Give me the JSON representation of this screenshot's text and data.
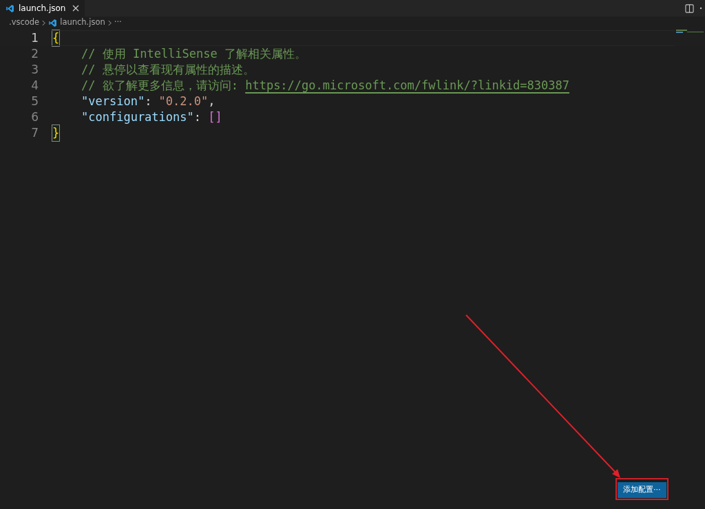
{
  "tabs": [
    {
      "label": "launch.json",
      "selected": true
    }
  ],
  "breadcrumbs": [
    {
      "label": ".vscode",
      "kind": "folder"
    },
    {
      "label": "launch.json",
      "kind": "file"
    },
    {
      "label": "···",
      "kind": "more"
    }
  ],
  "lines": [
    {
      "number": "1",
      "current": true,
      "indented": false,
      "tokens": [
        {
          "kind": "brace",
          "text": "{",
          "matched": true
        }
      ]
    },
    {
      "number": "2",
      "current": false,
      "indented": true,
      "tokens": [
        {
          "kind": "comment",
          "text": "// 使用 IntelliSense 了解相关属性。"
        }
      ]
    },
    {
      "number": "3",
      "current": false,
      "indented": true,
      "tokens": [
        {
          "kind": "comment",
          "text": "// 悬停以查看现有属性的描述。"
        }
      ]
    },
    {
      "number": "4",
      "current": false,
      "indented": true,
      "tokens": [
        {
          "kind": "comment",
          "text": "// 欲了解更多信息，请访问: "
        },
        {
          "kind": "link",
          "text": "https://go.microsoft.com/fwlink/?linkid=830387"
        }
      ]
    },
    {
      "number": "5",
      "current": false,
      "indented": true,
      "tokens": [
        {
          "kind": "key",
          "text": "\"version\""
        },
        {
          "kind": "punct",
          "text": ": "
        },
        {
          "kind": "string",
          "text": "\"0.2.0\""
        },
        {
          "kind": "punct",
          "text": ","
        }
      ]
    },
    {
      "number": "6",
      "current": false,
      "indented": true,
      "tokens": [
        {
          "kind": "key",
          "text": "\"configurations\""
        },
        {
          "kind": "punct",
          "text": ": "
        },
        {
          "kind": "bracket",
          "text": "[]"
        }
      ]
    },
    {
      "number": "7",
      "current": false,
      "indented": false,
      "tokens": [
        {
          "kind": "brace",
          "text": "}",
          "matched": true
        }
      ]
    }
  ],
  "add_button": {
    "label": "添加配置···"
  }
}
